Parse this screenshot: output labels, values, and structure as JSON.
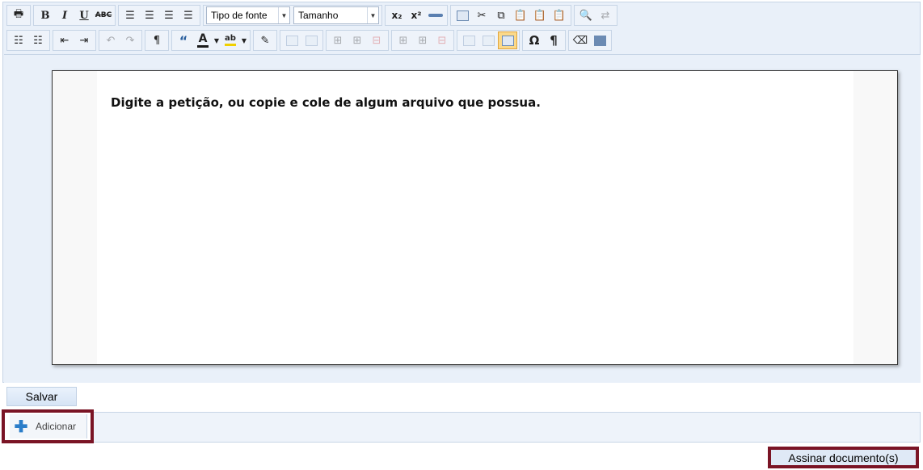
{
  "toolbar": {
    "font_combo_label": "Tipo de fonte",
    "size_combo_label": "Tamanho",
    "bold_glyph": "B",
    "italic_glyph": "I",
    "underline_glyph": "U",
    "strike_glyph": "ABC",
    "subscript_glyph": "x₂",
    "superscript_glyph": "x²",
    "quote_glyph": "“",
    "text_color_glyph": "A",
    "highlight_glyph": "ab",
    "special_char_glyph": "Ω",
    "pilcrow_glyph": "¶",
    "text_color": "#1a1a1a",
    "highlight_color": "#f0d000"
  },
  "editor": {
    "placeholder_text": "Digite a petição, ou copie e cole de algum arquivo que possua."
  },
  "actions": {
    "save_label": "Salvar",
    "add_label": "Adicionar",
    "sign_label": "Assinar documento(s)"
  },
  "colors": {
    "highlight_border": "#7a1425",
    "accent_blue": "#2a7dc9"
  }
}
